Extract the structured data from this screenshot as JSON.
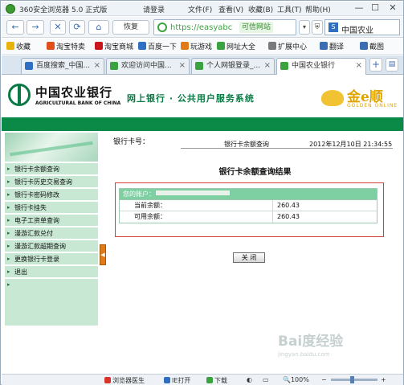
{
  "browser": {
    "title": "360安全浏览器 5.0 正式版",
    "login": "请登录",
    "menus": [
      "文件(F)",
      "查看(V)",
      "收藏(B)",
      "工具(T)",
      "帮助(H)"
    ],
    "window_buttons": [
      "—",
      "☐",
      "✕"
    ],
    "nav": {
      "back": "←",
      "forward": "→",
      "stop": "✕",
      "refresh": "⟳",
      "home": "⌂",
      "restore_label": "恢复",
      "url": "https://easyabc",
      "safe_badge": "可信网站",
      "search_value": "中国农业"
    },
    "favorites": [
      {
        "label": "收藏",
        "color": "#e8b20c"
      },
      {
        "label": "淘宝特卖",
        "color": "#e04e1b"
      },
      {
        "label": "淘宝商城",
        "color": "#c8161d"
      },
      {
        "label": "百度一下",
        "color": "#2f6fc2"
      },
      {
        "label": "玩游戏",
        "color": "#e07b18"
      },
      {
        "label": "网址大全",
        "color": "#3aa340"
      },
      {
        "label": "扩展中心",
        "color": "#7a7a7a"
      },
      {
        "label": "翻译",
        "color": "#3b6db3"
      },
      {
        "label": "截图",
        "color": "#3b6db3"
      }
    ],
    "tabs": [
      {
        "label": "百度搜索_中国...",
        "color": "#2f6fc2"
      },
      {
        "label": "欢迎访问中国...",
        "color": "#3aa340"
      },
      {
        "label": "个人网银登录_...",
        "color": "#3aa340"
      },
      {
        "label": "中国农业银行",
        "color": "#3aa340"
      }
    ],
    "tab_close": "×",
    "status": {
      "doctor": "浏览器医生",
      "ie": "IE打开",
      "download": "下载",
      "zoom": "100%"
    }
  },
  "bank": {
    "name_cn": "中国农业银行",
    "name_en": "AGRICULTURAL BANK OF CHINA",
    "service": "网上银行 · 公共用户服务系统",
    "golden_cn": "金e顺",
    "golden_en": "GOLDEN ONLINE",
    "menu": [
      "银行卡余额查询",
      "银行卡历史交易查询",
      "银行卡密码修改",
      "银行卡挂失",
      "电子工资单查询",
      "漫游汇款兑付",
      "漫游汇款超期查询",
      "更换银行卡登录",
      "退出"
    ],
    "toggle": "◀"
  },
  "content": {
    "card_label": "银行卡号：",
    "page_title": "银行卡余额查询",
    "datetime": "2012年12月10日 21:34:55",
    "result_title": "银行卡余额查询结果",
    "account_label": "您的账户：",
    "rows": [
      {
        "label": "当前余额：",
        "value": "260.43"
      },
      {
        "label": "可用余额：",
        "value": "260.43"
      }
    ],
    "close_button": "关 闭"
  },
  "watermark": {
    "brand": "Bai度经验",
    "url": "jingyan.baidu.com"
  }
}
